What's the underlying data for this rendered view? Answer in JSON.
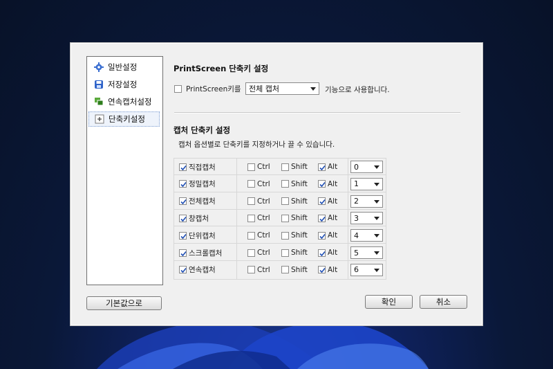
{
  "sidebar": {
    "items": [
      {
        "label": "일반설정",
        "icon": "gear-icon",
        "selected": false
      },
      {
        "label": "저장설정",
        "icon": "save-icon",
        "selected": false
      },
      {
        "label": "연속캡처설정",
        "icon": "continuous-capture-icon",
        "selected": false
      },
      {
        "label": "단축키설정",
        "icon": "shortcut-icon",
        "selected": true
      }
    ]
  },
  "printscreen": {
    "title": "PrintScreen 단축키 설정",
    "checkbox_label": "PrintScreen키를",
    "checked": false,
    "combo_value": "전체 캡처",
    "suffix": "기능으로 사용합니다."
  },
  "capture": {
    "title": "캡처 단축키 설정",
    "description": "캡처 옵션별로 단축키를 지정하거나 끌 수 있습니다.",
    "rows": [
      {
        "name": "직접캡처",
        "enabled": true,
        "ctrl": false,
        "shift": false,
        "alt": true,
        "key": "0"
      },
      {
        "name": "정밀캡처",
        "enabled": true,
        "ctrl": false,
        "shift": false,
        "alt": true,
        "key": "1"
      },
      {
        "name": "전체캡처",
        "enabled": true,
        "ctrl": false,
        "shift": false,
        "alt": true,
        "key": "2"
      },
      {
        "name": "창캡처",
        "enabled": true,
        "ctrl": false,
        "shift": false,
        "alt": true,
        "key": "3"
      },
      {
        "name": "단위캡처",
        "enabled": true,
        "ctrl": false,
        "shift": false,
        "alt": true,
        "key": "4"
      },
      {
        "name": "스크롤캡처",
        "enabled": true,
        "ctrl": false,
        "shift": false,
        "alt": true,
        "key": "5"
      },
      {
        "name": "연속캡처",
        "enabled": true,
        "ctrl": false,
        "shift": false,
        "alt": true,
        "key": "6"
      }
    ],
    "ctrl_label": "Ctrl",
    "shift_label": "Shift",
    "alt_label": "Alt"
  },
  "buttons": {
    "default": "기본값으로",
    "ok": "확인",
    "cancel": "취소"
  },
  "colors": {
    "check_mark": "#1f4fb5",
    "desktop_bg": "#0a1838",
    "swirl": "#2447c8"
  }
}
